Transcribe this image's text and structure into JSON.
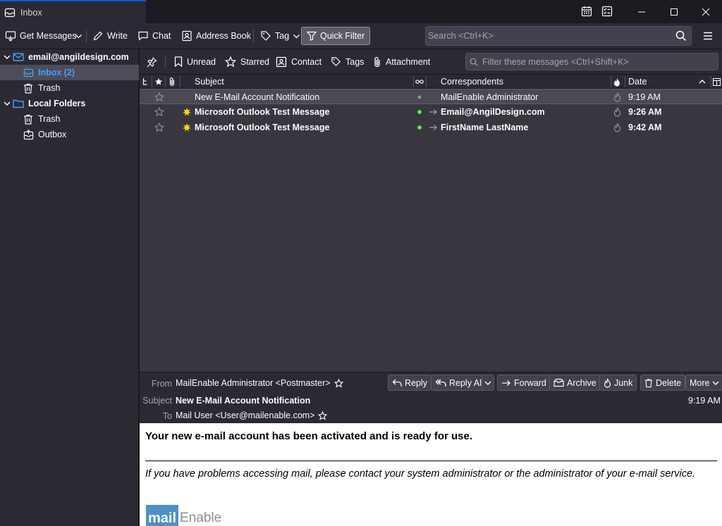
{
  "window": {
    "tab_title": "Inbox"
  },
  "toolbar": {
    "get_messages": "Get Messages",
    "write": "Write",
    "chat": "Chat",
    "address_book": "Address Book",
    "tag": "Tag",
    "quick_filter": "Quick Filter",
    "search_placeholder": "Search <Ctrl+K>"
  },
  "sidebar": {
    "account": "email@angildesign.com",
    "inbox": "Inbox (2)",
    "account_trash": "Trash",
    "local_folders": "Local Folders",
    "local_trash": "Trash",
    "outbox": "Outbox"
  },
  "quickfilter": {
    "unread": "Unread",
    "starred": "Starred",
    "contact": "Contact",
    "tags": "Tags",
    "attachment": "Attachment",
    "filter_placeholder": "Filter these messages <Ctrl+Shift+K>"
  },
  "columns": {
    "subject": "Subject",
    "correspondents": "Correspondents",
    "date": "Date"
  },
  "messages": [
    {
      "subject": "New E-Mail Account Notification",
      "correspondent": "MailEnable Administrator",
      "date": "9:19 AM",
      "unread": false,
      "selected": true
    },
    {
      "subject": "Microsoft Outlook Test Message",
      "correspondent": "Email@AngilDesign.com",
      "date": "9:26 AM",
      "unread": true,
      "selected": false
    },
    {
      "subject": "Microsoft Outlook Test Message",
      "correspondent": "FirstName LastName",
      "date": "9:42 AM",
      "unread": true,
      "selected": false
    }
  ],
  "message_header": {
    "from_label": "From",
    "from_value": "MailEnable Administrator <Postmaster>",
    "subject_label": "Subject",
    "subject_value": "New E-Mail Account Notification",
    "to_label": "To",
    "to_value": "Mail User <User@mailenable.com>",
    "time": "9:19 AM",
    "buttons": {
      "reply": "Reply",
      "reply_all": "Reply All",
      "forward": "Forward",
      "archive": "Archive",
      "junk": "Junk",
      "delete": "Delete",
      "more": "More"
    }
  },
  "message_body": {
    "headline": "Your new e-mail account has been activated and is ready for use.",
    "note": "If you have problems accessing mail, please contact your system administrator or the administrator of your e-mail service.",
    "logo_mail": "mail",
    "logo_enable": "Enable"
  },
  "colors": {
    "accent": "#0060df",
    "inbox_text": "#45a1ff",
    "new_star": "#ffd814",
    "online_dot": "#54ff4e"
  }
}
